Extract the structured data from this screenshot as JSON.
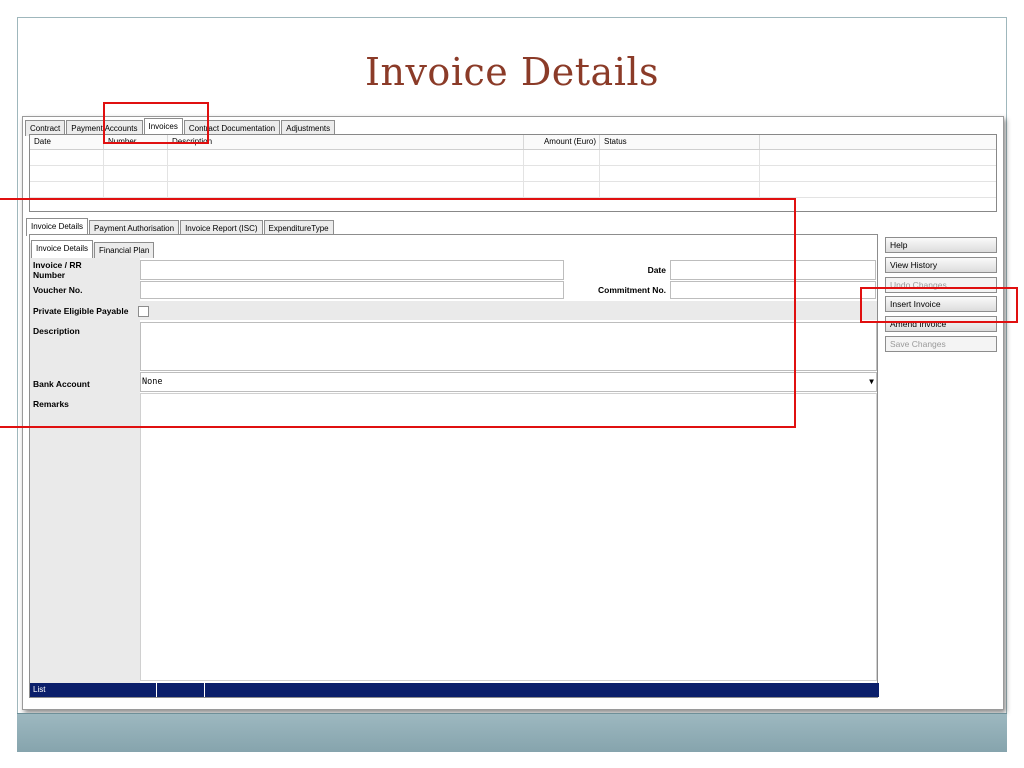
{
  "slide": {
    "title": "Invoice Details"
  },
  "top_tabs": [
    {
      "label": "Contract"
    },
    {
      "label": "Payment Accounts"
    },
    {
      "label": "Invoices"
    },
    {
      "label": "Contract Documentation"
    },
    {
      "label": "Adjustments"
    }
  ],
  "grid": {
    "columns": [
      "Date",
      "Number",
      "Description",
      "Amount (Euro)",
      "Status"
    ]
  },
  "detail_tabs": [
    {
      "label": "Invoice Details"
    },
    {
      "label": "Payment Authorisation"
    },
    {
      "label": "Invoice Report (ISC)"
    },
    {
      "label": "ExpenditureType"
    }
  ],
  "sub_tabs": [
    {
      "label": "Invoice Details"
    },
    {
      "label": "Financial Plan"
    }
  ],
  "form": {
    "invoice_rr_number_label": "Invoice / RR Number",
    "voucher_no_label": "Voucher No.",
    "private_eligible_label": "Private Eligible Payable",
    "description_label": "Description",
    "bank_account_label": "Bank Account",
    "bank_account_value": "None",
    "remarks_label": "Remarks",
    "date_label": "Date",
    "commitment_no_label": "Commitment No."
  },
  "status_bar": {
    "label": "List"
  },
  "side_buttons": [
    {
      "label": "Help",
      "enabled": true
    },
    {
      "label": "View History",
      "enabled": true
    },
    {
      "label": "Undo Changes",
      "enabled": false
    },
    {
      "label": "Insert Invoice",
      "enabled": true
    },
    {
      "label": "Amend Invoice",
      "enabled": true
    },
    {
      "label": "Save Changes",
      "enabled": false
    }
  ],
  "colors": {
    "title": "#8b3b28",
    "highlight": "#e01010",
    "status_bar": "#0b1f6b",
    "footer": "#8fa9b1"
  },
  "icons": [
    "checkbox-icon",
    "chevron-down-icon"
  ]
}
